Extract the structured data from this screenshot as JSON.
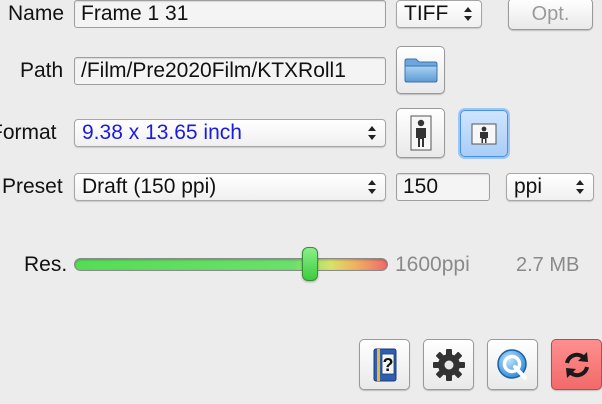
{
  "name_row": {
    "label": "Name",
    "value": "Frame 1 31",
    "format_value": "TIFF",
    "options_button": "Opt."
  },
  "path_row": {
    "label": "Path",
    "value": "/Film/Pre2020Film/KTXRoll1"
  },
  "format_row": {
    "label": "Format",
    "value": "9.38 x 13.65 inch",
    "value_color": "#1a1ae0"
  },
  "preset_row": {
    "label": "Preset",
    "value": "Draft (150 ppi)",
    "resolution": "150",
    "unit": "ppi"
  },
  "res_row": {
    "label": "Res.",
    "slider_level_pct": 75,
    "resolution_text": "1600ppi",
    "file_size": "2.7 MB"
  },
  "icons": {
    "folder": "folder-icon",
    "portrait": "portrait-orientation-icon",
    "landscape": "landscape-orientation-icon",
    "help": "help-book-icon",
    "settings": "gear-icon",
    "quicktime": "quicktime-icon",
    "reset": "reset-icon"
  }
}
